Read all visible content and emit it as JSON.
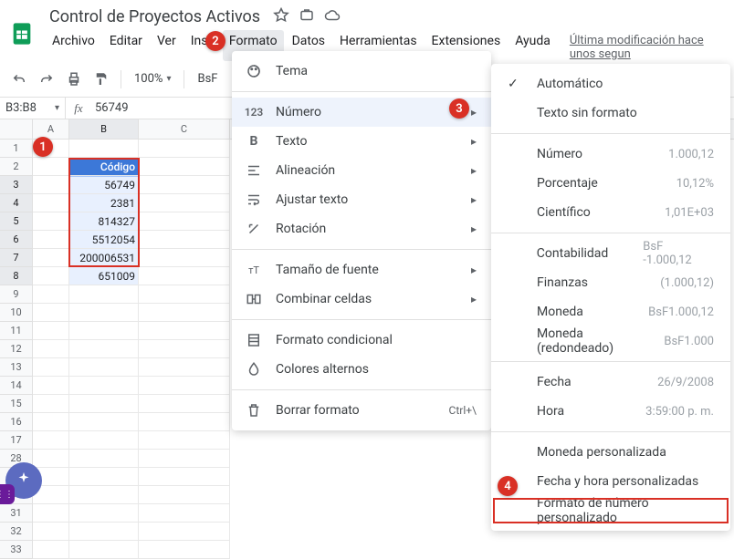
{
  "doc": {
    "title": "Control de Proyectos Activos"
  },
  "lastedit": "Última modificación hace unos segun",
  "menubar": {
    "archivo": "Archivo",
    "editar": "Editar",
    "ver": "Ver",
    "insertar": "Inse",
    "formato": "Formato",
    "datos": "Datos",
    "herramientas": "Herramientas",
    "extensiones": "Extensiones",
    "ayuda": "Ayuda"
  },
  "toolbar": {
    "zoom": "100%",
    "currency": "BsF"
  },
  "namebox": "B3:B8",
  "formula_value": "56749",
  "columns": {
    "A": "A",
    "B": "B",
    "C": "C"
  },
  "cells": {
    "b2": "Código",
    "b3": "56749",
    "b4": "2381",
    "b5": "814327",
    "b6": "5512054",
    "b7": "200006531",
    "b8": "651009"
  },
  "format_menu": {
    "tema": "Tema",
    "numero": "Número",
    "texto": "Texto",
    "alineacion": "Alineación",
    "ajustar": "Ajustar texto",
    "rotacion": "Rotación",
    "fuente": "Tamaño de fuente",
    "combinar": "Combinar celdas",
    "condicional": "Formato condicional",
    "colores": "Colores alternos",
    "borrar": "Borrar formato",
    "borrar_sc": "Ctrl+\\"
  },
  "number_submenu": {
    "auto": "Automático",
    "plain": "Texto sin formato",
    "numero": "Número",
    "numero_s": "1.000,12",
    "pct": "Porcentaje",
    "pct_s": "10,12%",
    "sci": "Científico",
    "sci_s": "1,01E+03",
    "cont": "Contabilidad",
    "cont_s": "BsF -1.000,12",
    "fin": "Finanzas",
    "fin_s": "(1.000,12)",
    "mon": "Moneda",
    "mon_s": "BsF1.000,12",
    "monr": "Moneda (redondeado)",
    "monr_s": "BsF1.000",
    "fecha": "Fecha",
    "fecha_s": "26/9/2008",
    "hora": "Hora",
    "hora_s": "3:59:00 p. m.",
    "cmon": "Moneda personalizada",
    "cdate": "Fecha y hora personalizadas",
    "cnum": "Formato de número personalizado"
  },
  "callouts": {
    "c1": "1",
    "c2": "2",
    "c3": "3",
    "c4": "4"
  }
}
